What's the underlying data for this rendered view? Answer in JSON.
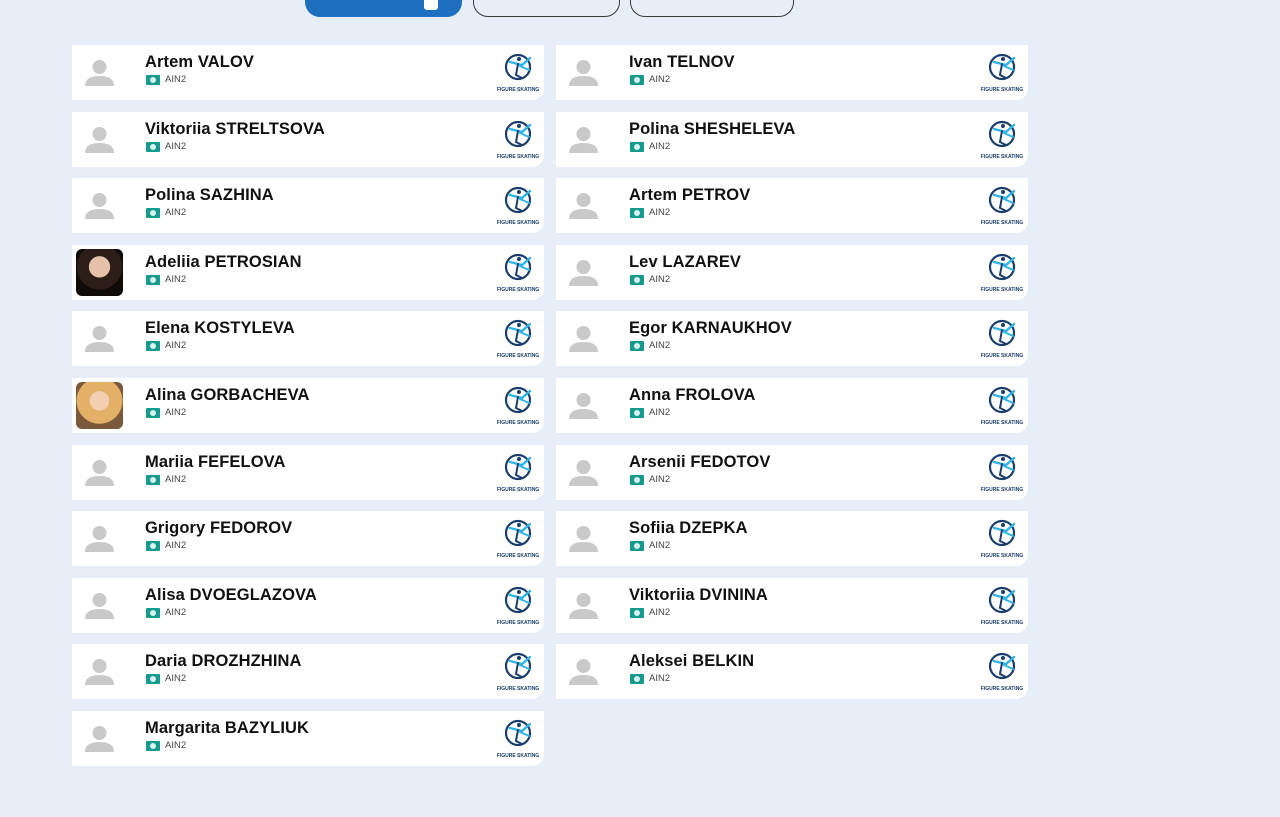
{
  "athletes": [
    {
      "name": "Artem VALOV",
      "code": "AIN2",
      "photo": false
    },
    {
      "name": "Ivan TELNOV",
      "code": "AIN2",
      "photo": false
    },
    {
      "name": "Viktoriia STRELTSOVA",
      "code": "AIN2",
      "photo": false
    },
    {
      "name": "Polina SHESHELEVA",
      "code": "AIN2",
      "photo": false
    },
    {
      "name": "Polina SAZHINA",
      "code": "AIN2",
      "photo": false
    },
    {
      "name": "Artem PETROV",
      "code": "AIN2",
      "photo": false
    },
    {
      "name": "Adeliia PETROSIAN",
      "code": "AIN2",
      "photo": true
    },
    {
      "name": "Lev LAZAREV",
      "code": "AIN2",
      "photo": false
    },
    {
      "name": "Elena KOSTYLEVA",
      "code": "AIN2",
      "photo": false
    },
    {
      "name": "Egor KARNAUKHOV",
      "code": "AIN2",
      "photo": false
    },
    {
      "name": "Alina GORBACHEVA",
      "code": "AIN2",
      "photo": true
    },
    {
      "name": "Anna FROLOVA",
      "code": "AIN2",
      "photo": false
    },
    {
      "name": "Mariia FEFELOVA",
      "code": "AIN2",
      "photo": false
    },
    {
      "name": "Arsenii FEDOTOV",
      "code": "AIN2",
      "photo": false
    },
    {
      "name": "Grigory FEDOROV",
      "code": "AIN2",
      "photo": false
    },
    {
      "name": "Sofiia DZEPKA",
      "code": "AIN2",
      "photo": false
    },
    {
      "name": "Alisa DVOEGLAZOVA",
      "code": "AIN2",
      "photo": false
    },
    {
      "name": "Viktoriia DVININA",
      "code": "AIN2",
      "photo": false
    },
    {
      "name": "Daria DROZHZHINA",
      "code": "AIN2",
      "photo": false
    },
    {
      "name": "Aleksei BELKIN",
      "code": "AIN2",
      "photo": false
    },
    {
      "name": "Margarita BAZYLIUK",
      "code": "AIN2",
      "photo": false
    }
  ],
  "logo_text": "FIGURE SKATING",
  "colors": {
    "background": "#e7eef8",
    "accent": "#1f6fc0",
    "flag": "#159a8e"
  }
}
